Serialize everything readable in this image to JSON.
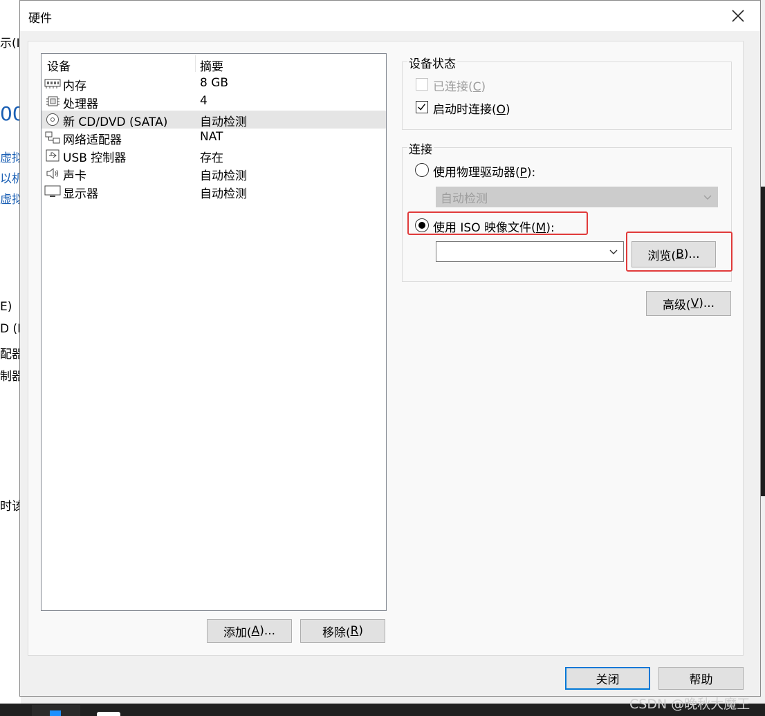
{
  "background_app": {
    "fragments": [
      "示(I)",
      "00",
      "虚拟机",
      "以机设",
      "虚拟机",
      "E)",
      "D (ID",
      "配器",
      "制器",
      "时该"
    ]
  },
  "dialog": {
    "title": "硬件",
    "device_list": {
      "headers": {
        "device": "设备",
        "summary": "摘要"
      },
      "rows": [
        {
          "icon": "memory-icon",
          "name": "内存",
          "summary": "8 GB",
          "selected": false
        },
        {
          "icon": "cpu-icon",
          "name": "处理器",
          "summary": "4",
          "selected": false
        },
        {
          "icon": "cd-dvd-icon",
          "name": "新 CD/DVD (SATA)",
          "summary": "自动检测",
          "selected": true
        },
        {
          "icon": "network-adapter-icon",
          "name": "网络适配器",
          "summary": "NAT",
          "selected": false
        },
        {
          "icon": "usb-icon",
          "name": "USB 控制器",
          "summary": "存在",
          "selected": false
        },
        {
          "icon": "speaker-icon",
          "name": "声卡",
          "summary": "自动检测",
          "selected": false
        },
        {
          "icon": "monitor-icon",
          "name": "显示器",
          "summary": "自动检测",
          "selected": false
        }
      ]
    },
    "buttons": {
      "add": {
        "text": "添加(",
        "key": "A",
        "tail": ")..."
      },
      "remove": {
        "text": "移除(",
        "key": "R",
        "tail": ")"
      },
      "close": "关闭",
      "help": "帮助"
    },
    "device_status": {
      "label": "设备状态",
      "connected": {
        "text": "已连接(",
        "key": "C",
        "tail": ")",
        "checked": false,
        "enabled": false
      },
      "connect_at_power_on": {
        "text": "启动时连接(",
        "key": "O",
        "tail": ")",
        "checked": true,
        "enabled": true
      }
    },
    "connection": {
      "label": "连接",
      "physical_drive": {
        "text": "使用物理驱动器(",
        "key": "P",
        "tail": "):",
        "selected": false
      },
      "physical_drive_value": "自动检测",
      "iso_image": {
        "text": "使用 ISO 映像文件(",
        "key": "M",
        "tail": "):",
        "selected": true
      },
      "iso_path_value": "",
      "browse": {
        "text": "浏览(",
        "key": "B",
        "tail": ")..."
      }
    },
    "advanced": {
      "text": "高级(",
      "key": "V",
      "tail": ")..."
    },
    "highlight_color": "#e03a3a"
  },
  "watermark": "CSDN @晚秋大魔王"
}
